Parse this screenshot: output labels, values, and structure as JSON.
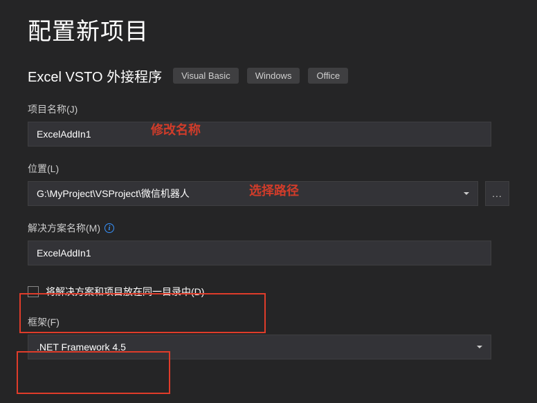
{
  "title": "配置新项目",
  "subtitle": "Excel VSTO 外接程序",
  "tags": [
    "Visual Basic",
    "Windows",
    "Office"
  ],
  "fields": {
    "projectName": {
      "label": "项目名称(J)",
      "value": "ExcelAddIn1"
    },
    "location": {
      "label": "位置(L)",
      "value": "G:\\MyProject\\VSProject\\微信机器人"
    },
    "solutionName": {
      "label": "解决方案名称(M)",
      "value": "ExcelAddIn1"
    },
    "sameDirectory": {
      "label": "将解决方案和项目放在同一目录中(D)"
    },
    "framework": {
      "label": "框架(F)",
      "value": ".NET Framework 4.5"
    }
  },
  "browseButton": "...",
  "annotations": {
    "modifyName": "修改名称",
    "selectPath": "选择路径"
  }
}
